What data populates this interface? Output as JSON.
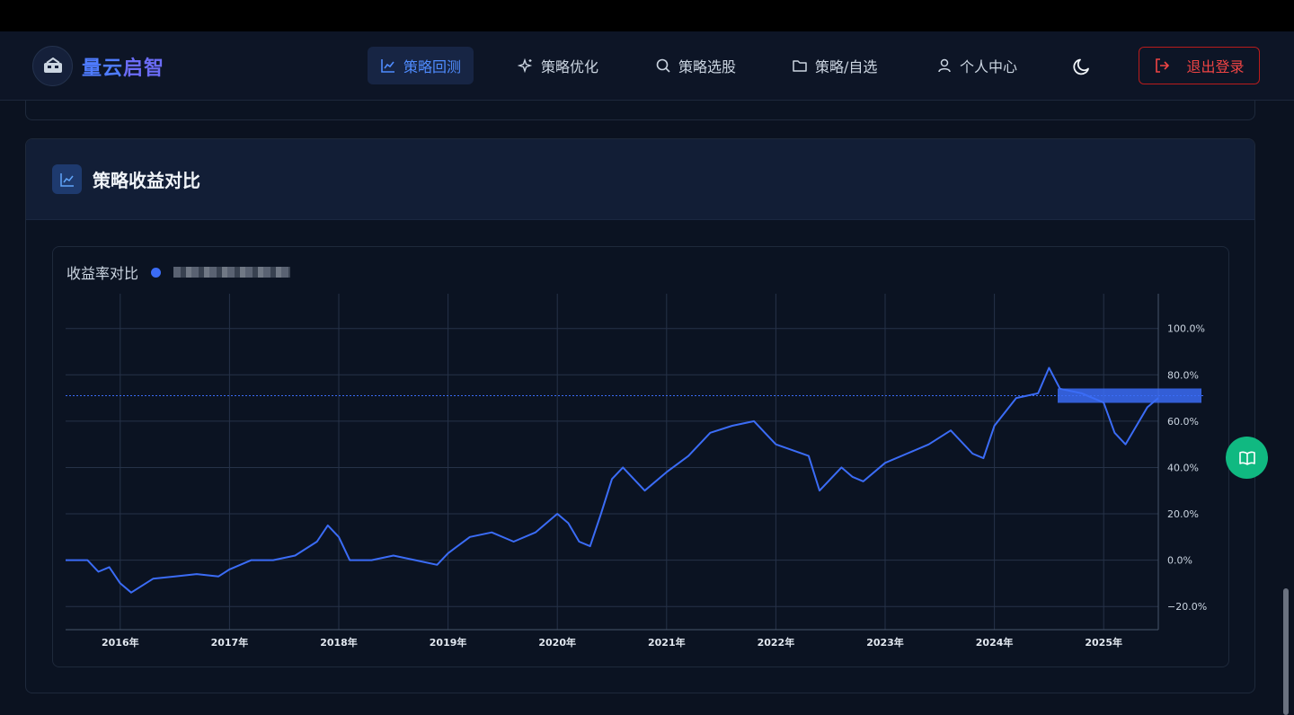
{
  "brand": {
    "name_a": "量云",
    "name_b": "启智"
  },
  "nav": {
    "items": [
      {
        "label": "策略回测",
        "icon": "line-chart-icon",
        "active": true
      },
      {
        "label": "策略优化",
        "icon": "sparkles-icon",
        "active": false
      },
      {
        "label": "策略选股",
        "icon": "search-icon",
        "active": false
      },
      {
        "label": "策略/自选",
        "icon": "folder-icon",
        "active": false
      },
      {
        "label": "个人中心",
        "icon": "user-icon",
        "active": false
      }
    ],
    "logout_label": "退出登录"
  },
  "card": {
    "title": "策略收益对比"
  },
  "colors": {
    "accent": "#3b6cf6",
    "danger": "#ef4444",
    "help": "#10b981"
  },
  "chart_data": {
    "type": "line",
    "title": "收益率对比",
    "x_tick_labels": [
      "2016年",
      "2017年",
      "2018年",
      "2019年",
      "2020年",
      "2021年",
      "2022年",
      "2023年",
      "2024年",
      "2025年"
    ],
    "y_tick_labels": [
      "100.0%",
      "80.0%",
      "60.0%",
      "40.0%",
      "20.0%",
      "0.0%",
      "−20.0%"
    ],
    "ylim": [
      -30,
      115
    ],
    "xlim": [
      2015.5,
      2025.5
    ],
    "grid": true,
    "y_axis_side": "right",
    "reference_line_y": 71,
    "series": [
      {
        "color": "#3b6cf6",
        "x": [
          2015.5,
          2015.7,
          2015.8,
          2015.9,
          2016.0,
          2016.1,
          2016.3,
          2016.5,
          2016.7,
          2016.9,
          2017.0,
          2017.2,
          2017.4,
          2017.6,
          2017.8,
          2017.9,
          2018.0,
          2018.1,
          2018.3,
          2018.5,
          2018.7,
          2018.9,
          2019.0,
          2019.2,
          2019.4,
          2019.6,
          2019.8,
          2020.0,
          2020.1,
          2020.2,
          2020.3,
          2020.4,
          2020.5,
          2020.6,
          2020.8,
          2021.0,
          2021.2,
          2021.4,
          2021.6,
          2021.8,
          2021.9,
          2022.0,
          2022.3,
          2022.4,
          2022.5,
          2022.6,
          2022.7,
          2022.8,
          2023.0,
          2023.2,
          2023.4,
          2023.6,
          2023.8,
          2023.9,
          2024.0,
          2024.2,
          2024.4,
          2024.5,
          2024.6,
          2024.8,
          2025.0,
          2025.1,
          2025.2,
          2025.3,
          2025.4,
          2025.5
        ],
        "y": [
          0,
          0,
          -5,
          -3,
          -10,
          -14,
          -8,
          -7,
          -6,
          -7,
          -4,
          0,
          0,
          2,
          8,
          15,
          10,
          0,
          0,
          2,
          0,
          -2,
          3,
          10,
          12,
          8,
          12,
          20,
          16,
          8,
          6,
          20,
          35,
          40,
          30,
          38,
          45,
          55,
          58,
          60,
          55,
          50,
          45,
          30,
          35,
          40,
          36,
          34,
          42,
          46,
          50,
          56,
          46,
          44,
          58,
          70,
          72,
          83,
          74,
          72,
          68,
          55,
          50,
          58,
          66,
          70
        ]
      }
    ]
  }
}
